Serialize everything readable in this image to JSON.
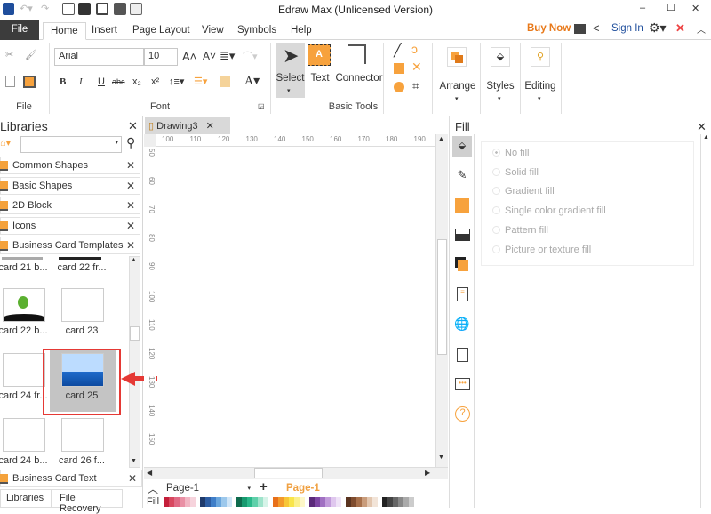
{
  "window": {
    "title": "Edraw Max (Unlicensed Version)",
    "minimize": "–",
    "maximize": "☐",
    "close": "✕"
  },
  "menu": {
    "tabs": [
      "File",
      "Home",
      "Insert",
      "Page Layout",
      "View",
      "Symbols",
      "Help"
    ],
    "active": "Home",
    "buy_now": "Buy Now",
    "sign_in": "Sign In"
  },
  "ribbon": {
    "file_group": "File",
    "font_group": "Font",
    "font_name": "Arial",
    "font_size": "10",
    "format_buttons": [
      "B",
      "I",
      "U",
      "abc",
      "x₂",
      "x²"
    ],
    "basic_tools_group": "Basic Tools",
    "select": "Select",
    "text": "Text",
    "connector": "Connector",
    "arrange": "Arrange",
    "styles": "Styles",
    "editing": "Editing"
  },
  "libraries": {
    "title": "Libraries",
    "search_placeholder": "",
    "items": [
      "Common Shapes",
      "Basic Shapes",
      "2D Block",
      "Icons",
      "Business Card Templates"
    ],
    "thumbnails": [
      [
        "card 21 b...",
        "card 22 fr..."
      ],
      [
        "card 22 b...",
        "card 23"
      ],
      [
        "card 24 fr...",
        "card 25"
      ],
      [
        "card 24 b...",
        "card 26 f..."
      ]
    ],
    "selected": "card 25",
    "bottom_item": "Business Card Text",
    "bottom_tabs": [
      "Libraries",
      "File Recovery"
    ]
  },
  "document": {
    "tab": "Drawing3",
    "hruler": [
      "100",
      "110",
      "120",
      "130",
      "140",
      "150",
      "160",
      "170",
      "180",
      "190"
    ],
    "vruler": [
      "50",
      "60",
      "70",
      "80",
      "90",
      "100",
      "110",
      "120",
      "130",
      "140",
      "150"
    ],
    "page_select": "Page-1",
    "page_tab": "Page-1",
    "fill_label": "Fill",
    "palette": [
      "#c41e3a",
      "#d8475f",
      "#e06a85",
      "#e98fa4",
      "#f1b5c3",
      "#f6d3dc",
      "#1f3a6b",
      "#2d5da3",
      "#3f7ec8",
      "#6aa6dd",
      "#9cc8ec",
      "#cfe5f7",
      "#0f6b4d",
      "#179a6f",
      "#2bb88a",
      "#5fd0aa",
      "#9fe3cb",
      "#d6f3e8",
      "#e8701a",
      "#f39a2b",
      "#f7c637",
      "#f9e54a",
      "#fbf08b",
      "#fdf7c8",
      "#5b2a7a",
      "#7e46a3",
      "#a070c2",
      "#c29cdb",
      "#dfc7ee",
      "#efe3f7",
      "#5a3420",
      "#7f4c2e",
      "#a7704b",
      "#c99c7b",
      "#e2c6af",
      "#f2e4d8",
      "#222222",
      "#444444",
      "#666666",
      "#888888",
      "#aaaaaa",
      "#cccccc"
    ]
  },
  "fill_panel": {
    "title": "Fill",
    "options": [
      "No fill",
      "Solid fill",
      "Gradient fill",
      "Single color gradient fill",
      "Pattern fill",
      "Picture or texture fill"
    ],
    "selected": "No fill"
  },
  "colors": {
    "accent": "#f7a23d",
    "buy": "#e8791a",
    "highlight": "#e53935",
    "file_tab": "#3c3c3c"
  }
}
